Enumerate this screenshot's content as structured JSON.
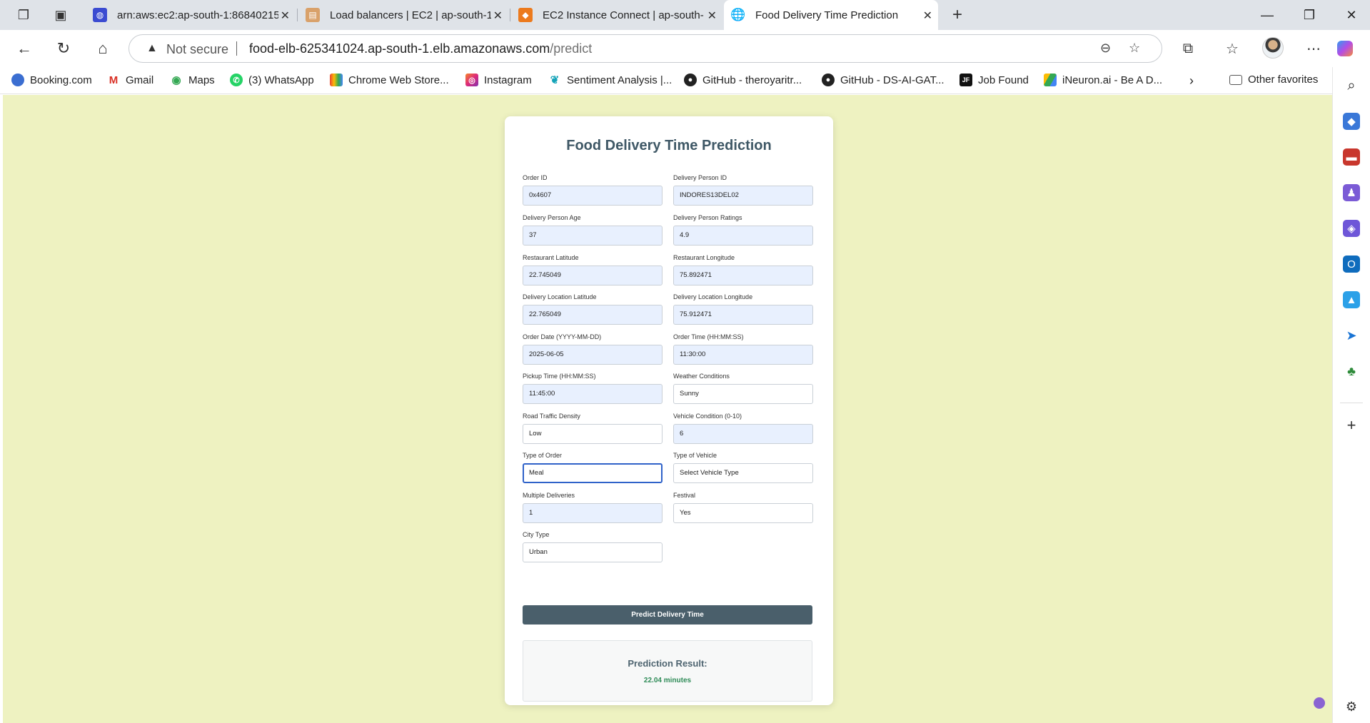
{
  "tabs": [
    {
      "label": "arn:aws:ec2:ap-south-1:86840215",
      "active": false
    },
    {
      "label": "Load balancers | EC2 | ap-south-1",
      "active": false
    },
    {
      "label": "EC2 Instance Connect | ap-south-",
      "active": false
    },
    {
      "label": "Food Delivery Time Prediction",
      "active": true
    }
  ],
  "addressbar": {
    "security": "Not secure",
    "host": "food-elb-625341024.ap-south-1.elb.amazonaws.com",
    "path": "/predict"
  },
  "bookmarks": [
    {
      "label": "Booking.com",
      "icon": "globe-icon"
    },
    {
      "label": "Gmail",
      "icon": "gmail-icon"
    },
    {
      "label": "Maps",
      "icon": "maps-icon"
    },
    {
      "label": "(3) WhatsApp",
      "icon": "whatsapp-icon"
    },
    {
      "label": "Chrome Web Store...",
      "icon": "rainbow-icon"
    },
    {
      "label": "Instagram",
      "icon": "instagram-icon"
    },
    {
      "label": "Sentiment Analysis |...",
      "icon": "leaf-icon"
    },
    {
      "label": "GitHub - theroyaritr...",
      "icon": "github-icon"
    },
    {
      "label": "GitHub - DS-AI-GAT...",
      "icon": "github-icon"
    },
    {
      "label": "Job Found",
      "icon": "jf-icon"
    },
    {
      "label": "iNeuron.ai - Be A D...",
      "icon": "drive-icon"
    }
  ],
  "other_favorites": "Other favorites",
  "form": {
    "title": "Food Delivery Time Prediction",
    "fields": [
      {
        "label": "Order ID",
        "value": "0x4607"
      },
      {
        "label": "Delivery Person ID",
        "value": "INDORES13DEL02"
      },
      {
        "label": "Delivery Person Age",
        "value": "37"
      },
      {
        "label": "Delivery Person Ratings",
        "value": "4.9"
      },
      {
        "label": "Restaurant Latitude",
        "value": "22.745049"
      },
      {
        "label": "Restaurant Longitude",
        "value": "75.892471"
      },
      {
        "label": "Delivery Location Latitude",
        "value": "22.765049"
      },
      {
        "label": "Delivery Location Longitude",
        "value": "75.912471"
      },
      {
        "label": "Order Date (YYYY-MM-DD)",
        "value": "2025-06-05"
      },
      {
        "label": "Order Time (HH:MM:SS)",
        "value": "11:30:00"
      },
      {
        "label": "Pickup Time (HH:MM:SS)",
        "value": "11:45:00"
      },
      {
        "label": "Weather Conditions",
        "value": "Sunny"
      },
      {
        "label": "Road Traffic Density",
        "value": "Low"
      },
      {
        "label": "Vehicle Condition (0-10)",
        "value": "6"
      },
      {
        "label": "Type of Order",
        "value": "Meal"
      },
      {
        "label": "Type of Vehicle",
        "value": "Select Vehicle Type"
      },
      {
        "label": "Multiple Deliveries",
        "value": "1"
      },
      {
        "label": "Festival",
        "value": "Yes"
      },
      {
        "label": "City Type",
        "value": "Urban"
      }
    ],
    "submit_label": "Predict Delivery Time",
    "result_title": "Prediction Result:",
    "result_value": "22.04 minutes"
  },
  "colors": {
    "page_bg": "#eef2c1",
    "button_bg": "#4a5f6b",
    "result_value": "#2e8b57",
    "autofill_bg": "#e8f0fe"
  }
}
